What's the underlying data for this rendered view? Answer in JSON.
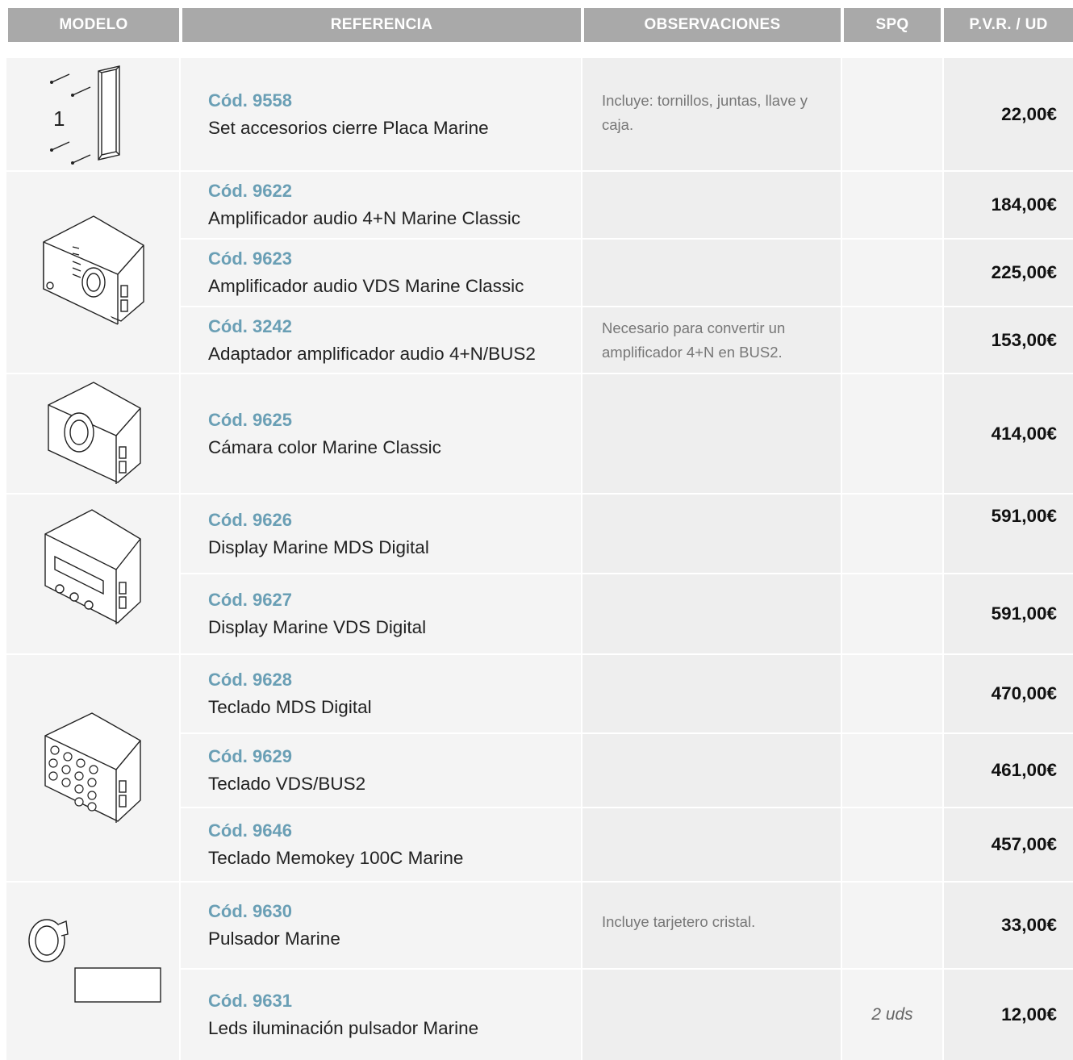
{
  "headers": {
    "modelo": "MODELO",
    "referencia": "REFERENCIA",
    "observaciones": "OBSERVACIONES",
    "spq": "SPQ",
    "pvr": "P.V.R. / UD"
  },
  "rows": [
    {
      "code": "Cód. 9558",
      "desc": "Set accesorios cierre Placa Marine",
      "obs": "Incluye: tornillos, juntas, llave y caja.",
      "spq": "",
      "price": "22,00€"
    },
    {
      "code": "Cód. 9622",
      "desc": "Amplificador audio 4+N Marine Classic",
      "obs": "",
      "spq": "",
      "price": "184,00€"
    },
    {
      "code": "Cód. 9623",
      "desc": "Amplificador audio VDS Marine Classic",
      "obs": "",
      "spq": "",
      "price": "225,00€"
    },
    {
      "code": "Cód. 3242",
      "desc": "Adaptador amplificador audio 4+N/BUS2",
      "obs": "Necesario para convertir un amplificador 4+N en BUS2.",
      "spq": "",
      "price": "153,00€"
    },
    {
      "code": "Cód. 9625",
      "desc": "Cámara color Marine Classic",
      "obs": "",
      "spq": "",
      "price": "414,00€"
    },
    {
      "code": "Cód. 9626",
      "desc": "Display Marine MDS Digital",
      "obs": "",
      "spq": "",
      "price": "591,00€"
    },
    {
      "code": "Cód. 9627",
      "desc": "Display Marine VDS Digital",
      "obs": "",
      "spq": "",
      "price": "591,00€"
    },
    {
      "code": "Cód. 9628",
      "desc": "Teclado MDS Digital",
      "obs": "",
      "spq": "",
      "price": "470,00€"
    },
    {
      "code": "Cód. 9629",
      "desc": "Teclado VDS/BUS2",
      "obs": "",
      "spq": "",
      "price": "461,00€"
    },
    {
      "code": "Cód. 9646",
      "desc": "Teclado Memokey 100C Marine",
      "obs": "",
      "spq": "",
      "price": "457,00€"
    },
    {
      "code": "Cód. 9630",
      "desc": "Pulsador Marine",
      "obs": "Incluye tarjetero cristal.",
      "spq": "",
      "price": "33,00€"
    },
    {
      "code": "Cód. 9631",
      "desc": "Leds iluminación pulsador Marine",
      "obs": "",
      "spq": "2 uds",
      "price": "12,00€"
    }
  ],
  "images": {
    "accessory_number": "1"
  }
}
